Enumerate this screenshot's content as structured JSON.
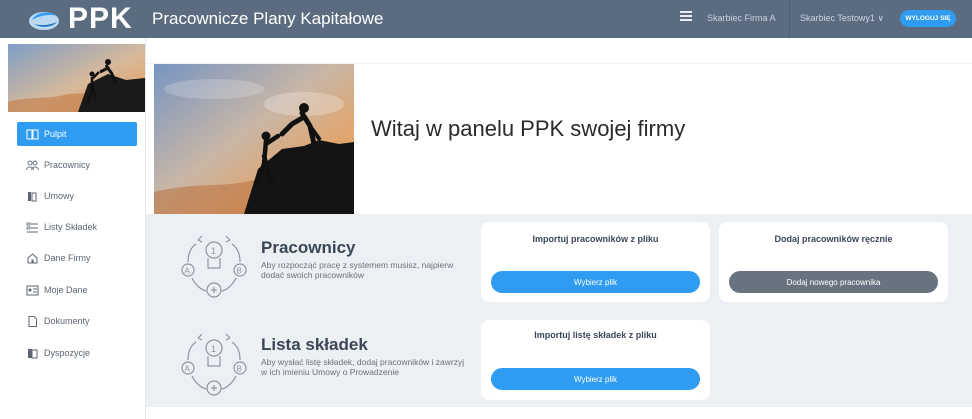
{
  "header": {
    "logo_text": "PPK",
    "app_title": "Pracownicze Plany Kapitałowe",
    "company": "Skarbiec Firma A",
    "user": "Skarbiec Testowy1 ∨",
    "logout_label": "WYLOGUJ SIĘ"
  },
  "sidebar": {
    "items": [
      {
        "label": "Pulpit",
        "icon": "book-icon"
      },
      {
        "label": "Pracownicy",
        "icon": "people-icon"
      },
      {
        "label": "Umowy",
        "icon": "documents-icon"
      },
      {
        "label": "Listy Składek",
        "icon": "list-icon"
      },
      {
        "label": "Dane Firmy",
        "icon": "home-icon"
      },
      {
        "label": "Moje Dane",
        "icon": "id-card-icon"
      },
      {
        "label": "Dokumenty",
        "icon": "file-icon"
      },
      {
        "label": "Dyspozycje",
        "icon": "folders-icon"
      }
    ]
  },
  "hero": {
    "title": "Witaj w panelu PPK swojej firmy"
  },
  "pracownicy": {
    "title": "Pracownicy",
    "description": "Aby rozpocząć pracę z systemem musisz, najpierw dodać swoich pracowników",
    "import_card": {
      "title": "Importuj pracowników z pliku",
      "button": "Wybierz plik"
    },
    "manual_card": {
      "title": "Dodaj pracowników ręcznie",
      "button": "Dodaj nowego pracownika"
    }
  },
  "skladki": {
    "title": "Lista składek",
    "description": "Aby wysłać listę składek, dodaj pracowników i zawrzyj w ich imieniu Umowy o Prowadzenie",
    "import_card": {
      "title": "Importuj listę składek z pliku",
      "button": "Wybierz plik"
    }
  },
  "colors": {
    "topbar": "#5b6c80",
    "accent": "#2f9cf2",
    "panel": "#eceff3",
    "dark_button": "#68737f"
  }
}
